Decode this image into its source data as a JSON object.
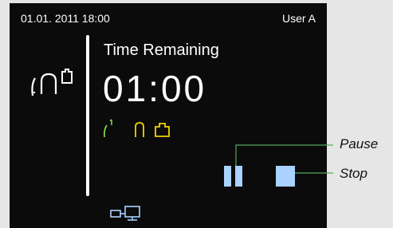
{
  "status_bar": {
    "datetime": "01.01. 2011 18:00",
    "user": "User A"
  },
  "main": {
    "title": "Time Remaining",
    "timer": "01:00"
  },
  "icons": {
    "device": "device-mode-icon",
    "modes": [
      "mode-left-icon",
      "mode-middle-icon",
      "mode-right-icon"
    ],
    "connection": "pc-connection-icon"
  },
  "controls": {
    "pause_label": "Pause",
    "stop_label": "Stop"
  },
  "colors": {
    "screen_bg": "#0b0b0b",
    "accent_blue": "#a9d2ff",
    "mode_green": "#7fd34a",
    "mode_yellow": "#f0d400",
    "page_bg": "#e6e6e6"
  }
}
